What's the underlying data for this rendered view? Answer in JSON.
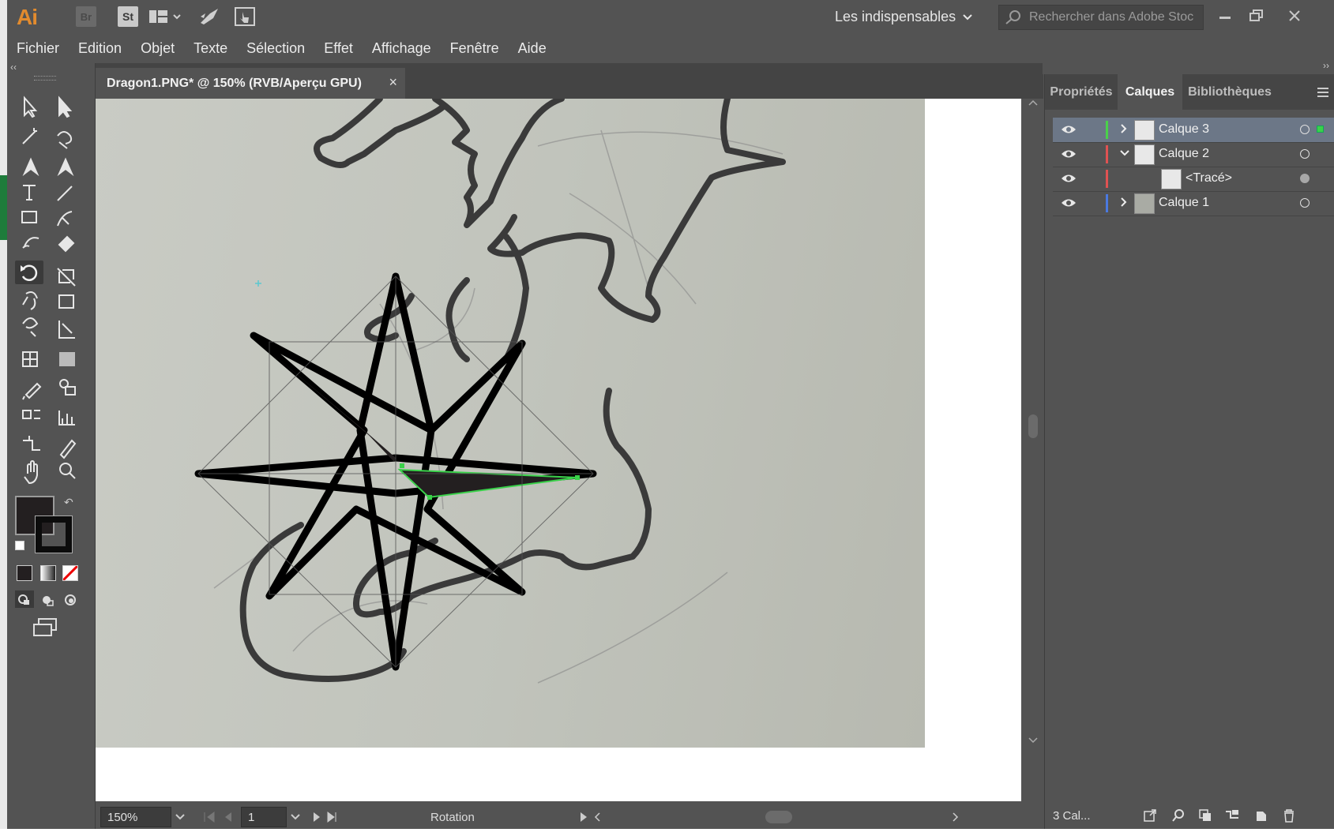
{
  "app": {
    "logo": "Ai",
    "bridge": "Br",
    "stock": "St"
  },
  "workspace": {
    "label": "Les indispensables"
  },
  "search": {
    "placeholder": "Rechercher dans Adobe Stoc"
  },
  "menu": [
    "Fichier",
    "Edition",
    "Objet",
    "Texte",
    "Sélection",
    "Effet",
    "Affichage",
    "Fenêtre",
    "Aide"
  ],
  "document": {
    "tab_title": "Dragon1.PNG* @ 150% (RVB/Aperçu GPU)",
    "close": "×"
  },
  "status": {
    "zoom": "150%",
    "artboard": "1",
    "tool_name": "Rotation"
  },
  "panel": {
    "tabs": [
      "Propriétés",
      "Calques",
      "Bibliothèques"
    ],
    "active_tab": "Calques",
    "layers": [
      {
        "name": "Calque 3",
        "color": "#4ad14a",
        "expanded": false,
        "selected": true
      },
      {
        "name": "Calque 2",
        "color": "#e05252",
        "expanded": true,
        "selected": false
      },
      {
        "name": "<Tracé>",
        "color": "#e05252",
        "sublayer": true
      },
      {
        "name": "Calque 1",
        "color": "#4a79e0",
        "expanded": false,
        "selected": false
      }
    ],
    "footer_count": "3 Cal..."
  },
  "colors": {
    "accent": "#e28b2e",
    "selected_row": "#6c7787",
    "selection_path": "#3ad14a"
  }
}
